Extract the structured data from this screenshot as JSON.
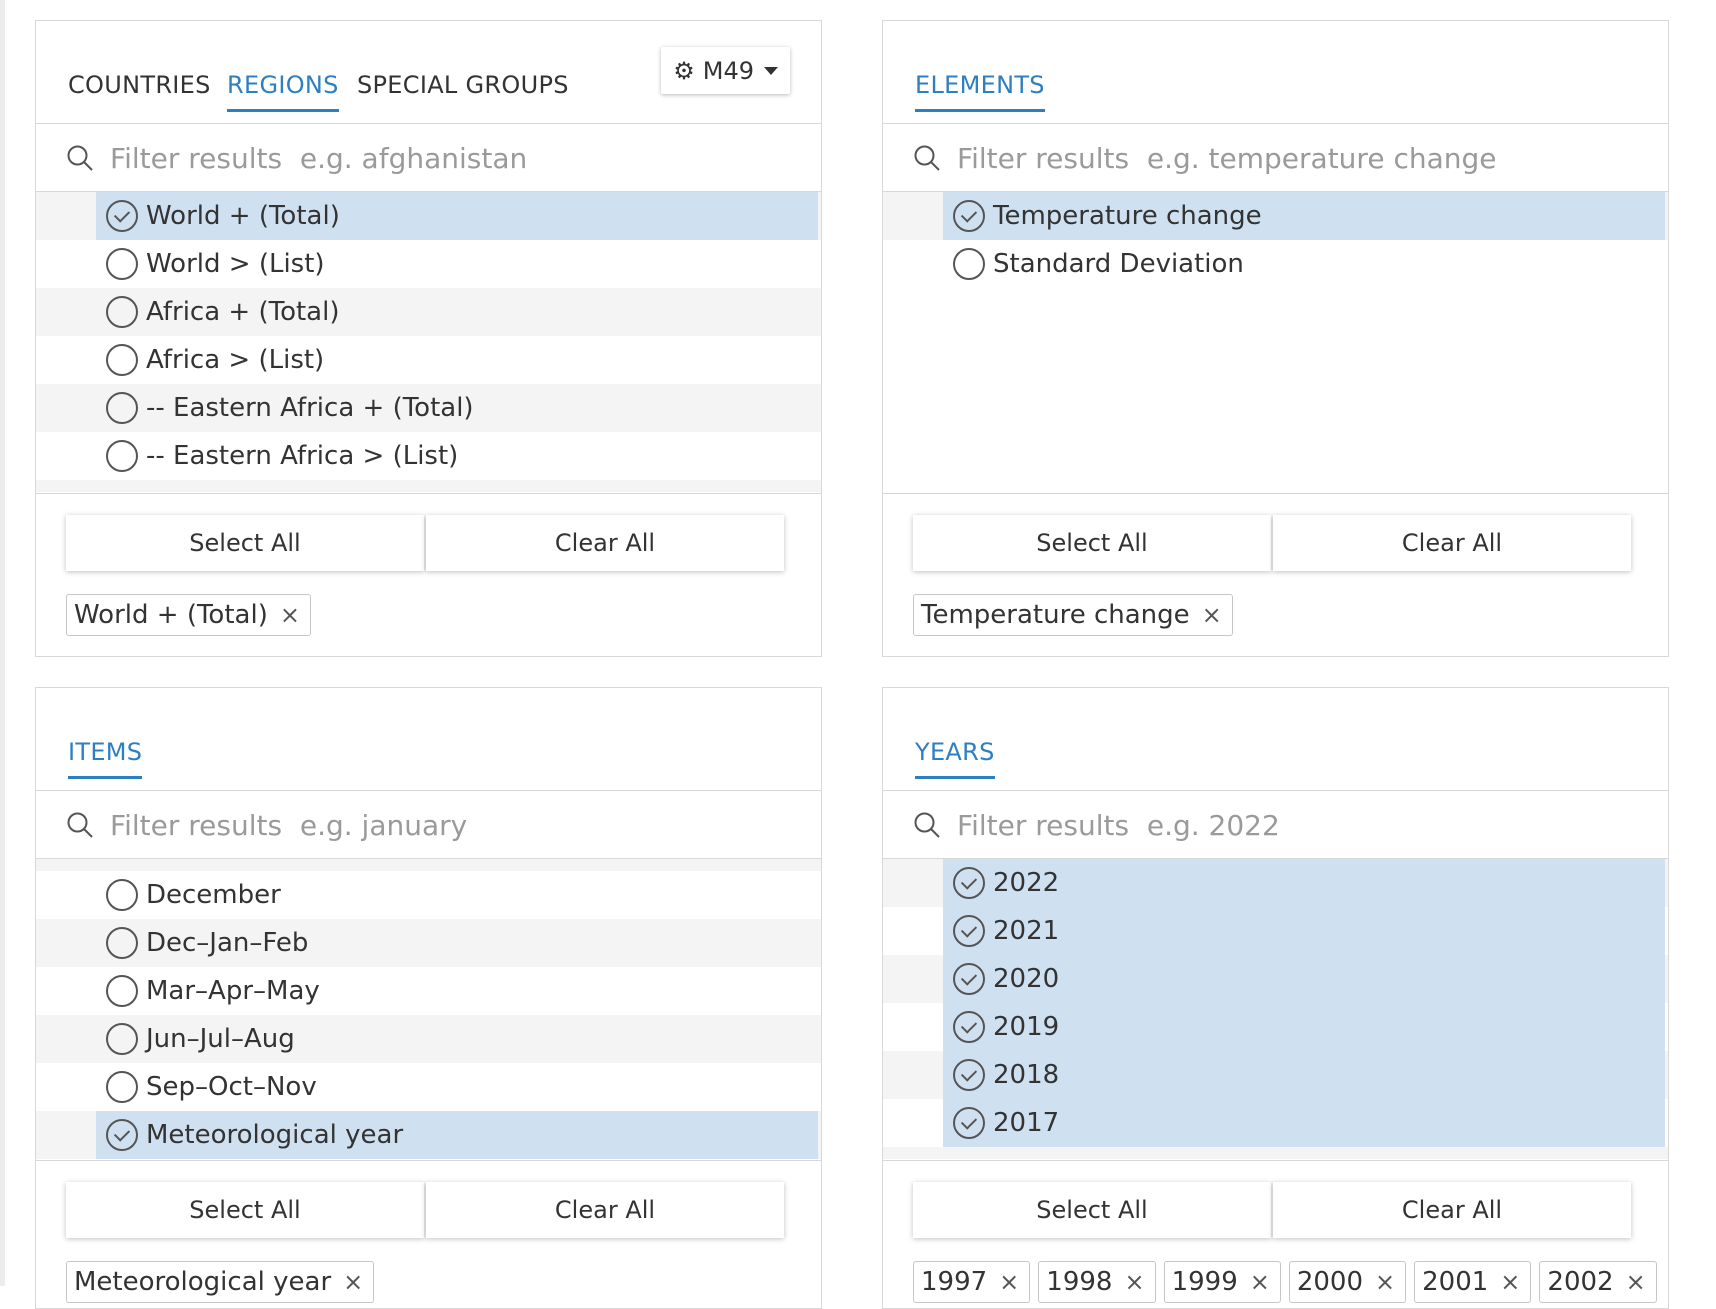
{
  "regions_panel": {
    "tabs": [
      {
        "label": "COUNTRIES"
      },
      {
        "label": "REGIONS"
      },
      {
        "label": "SPECIAL GROUPS"
      }
    ],
    "settings_button": {
      "label": "M49",
      "icon": "gear-icon"
    },
    "filter_placeholder": "Filter results  e.g. afghanistan",
    "rows": [
      {
        "label": "World + (Total)",
        "selected": true
      },
      {
        "label": "World > (List)",
        "selected": false
      },
      {
        "label": "Africa + (Total)",
        "selected": false
      },
      {
        "label": "Africa > (List)",
        "selected": false
      },
      {
        "label": "-- Eastern Africa + (Total)",
        "selected": false
      },
      {
        "label": "-- Eastern Africa > (List)",
        "selected": false
      }
    ],
    "select_all": "Select All",
    "clear_all": "Clear All",
    "chips": [
      "World + (Total)"
    ]
  },
  "elements_panel": {
    "tabs": [
      {
        "label": "ELEMENTS"
      }
    ],
    "filter_placeholder": "Filter results  e.g. temperature change",
    "rows": [
      {
        "label": "Temperature change",
        "selected": true
      },
      {
        "label": "Standard Deviation",
        "selected": false
      }
    ],
    "select_all": "Select All",
    "clear_all": "Clear All",
    "chips": [
      "Temperature change"
    ]
  },
  "items_panel": {
    "tabs": [
      {
        "label": "ITEMS"
      }
    ],
    "filter_placeholder": "Filter results  e.g. january",
    "rows": [
      {
        "label": "December",
        "selected": false
      },
      {
        "label": "Dec–Jan–Feb",
        "selected": false
      },
      {
        "label": "Mar–Apr–May",
        "selected": false
      },
      {
        "label": "Jun–Jul–Aug",
        "selected": false
      },
      {
        "label": "Sep–Oct–Nov",
        "selected": false
      },
      {
        "label": "Meteorological year",
        "selected": true
      }
    ],
    "select_all": "Select All",
    "clear_all": "Clear All",
    "chips": [
      "Meteorological year"
    ]
  },
  "years_panel": {
    "tabs": [
      {
        "label": "YEARS"
      }
    ],
    "filter_placeholder": "Filter results  e.g. 2022",
    "rows": [
      {
        "label": "2022",
        "selected": true
      },
      {
        "label": "2021",
        "selected": true
      },
      {
        "label": "2020",
        "selected": true
      },
      {
        "label": "2019",
        "selected": true
      },
      {
        "label": "2018",
        "selected": true
      },
      {
        "label": "2017",
        "selected": true
      }
    ],
    "select_all": "Select All",
    "clear_all": "Clear All",
    "chips": [
      "1997",
      "1998",
      "1999",
      "2000",
      "2001",
      "2002"
    ]
  },
  "chip_remove_glyph": "×",
  "colors": {
    "accent": "#2d7fc1",
    "selected_row": "#cfe1f1",
    "alt_row": "#f4f4f4"
  }
}
